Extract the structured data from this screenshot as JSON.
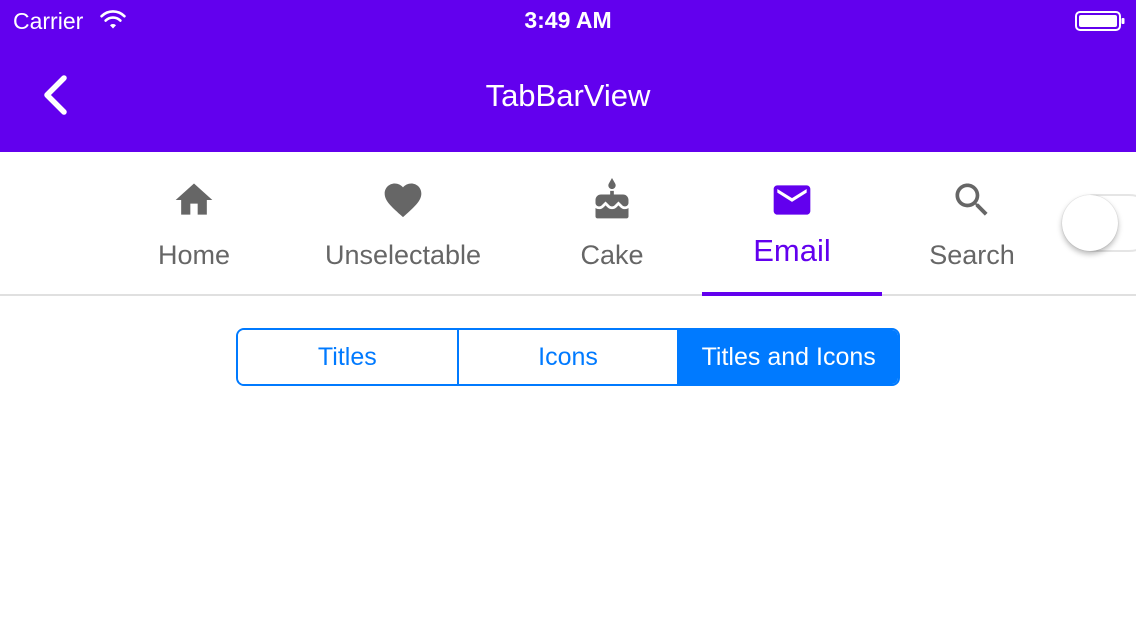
{
  "status_bar": {
    "carrier": "Carrier",
    "time": "3:49 AM",
    "wifi_icon": "wifi-icon",
    "battery_icon": "battery-icon"
  },
  "nav_bar": {
    "title": "TabBarView",
    "back_icon": "chevron-left-icon"
  },
  "tabs": [
    {
      "label": "Home",
      "icon": "home-icon",
      "selected": false
    },
    {
      "label": "Unselectable",
      "icon": "heart-icon",
      "selected": false
    },
    {
      "label": "Cake",
      "icon": "cake-icon",
      "selected": false
    },
    {
      "label": "Email",
      "icon": "email-icon",
      "selected": true
    },
    {
      "label": "Search",
      "icon": "search-icon",
      "selected": false
    }
  ],
  "toggle": {
    "on": false
  },
  "segmented_control": {
    "options": [
      "Titles",
      "Icons",
      "Titles and Icons"
    ],
    "selected_index": 2
  },
  "colors": {
    "header": "#6200ee",
    "tab_selected": "#6200ee",
    "tab_unselected": "#666666",
    "segment_accent": "#007aff"
  }
}
